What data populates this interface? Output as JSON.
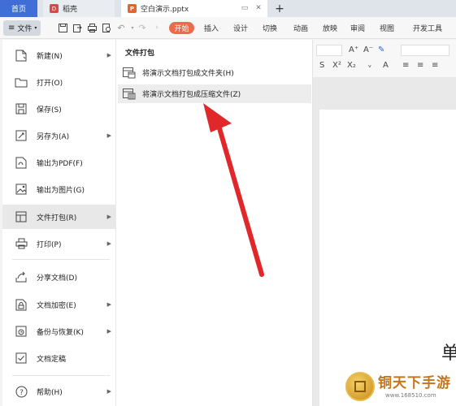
{
  "tabs": {
    "home": "首页",
    "docer": "稻壳",
    "document": "空白演示.pptx",
    "new_tab": "+"
  },
  "toolbar": {
    "file_menu": "文件",
    "ribbon_tabs": [
      "开始",
      "插入",
      "设计",
      "切换",
      "动画",
      "放映",
      "审阅",
      "视图",
      "开发工具"
    ]
  },
  "file_menu": {
    "items": [
      {
        "label": "新建(N)",
        "icon": "new-file-icon",
        "has_submenu": true
      },
      {
        "label": "打开(O)",
        "icon": "folder-open-icon",
        "has_submenu": false
      },
      {
        "label": "保存(S)",
        "icon": "save-icon",
        "has_submenu": false
      },
      {
        "label": "另存为(A)",
        "icon": "save-as-icon",
        "has_submenu": true
      },
      {
        "label": "输出为PDF(F)",
        "icon": "pdf-export-icon",
        "has_submenu": false
      },
      {
        "label": "输出为图片(G)",
        "icon": "image-export-icon",
        "has_submenu": false
      },
      {
        "label": "文件打包(R)",
        "icon": "package-icon",
        "has_submenu": true
      },
      {
        "label": "打印(P)",
        "icon": "printer-icon",
        "has_submenu": true
      },
      {
        "label": "分享文档(D)",
        "icon": "share-icon",
        "has_submenu": false
      },
      {
        "label": "文档加密(E)",
        "icon": "encrypt-icon",
        "has_submenu": true
      },
      {
        "label": "备份与恢复(K)",
        "icon": "backup-icon",
        "has_submenu": true
      },
      {
        "label": "文档定稿",
        "icon": "finalize-icon",
        "has_submenu": false
      },
      {
        "label": "帮助(H)",
        "icon": "help-icon",
        "has_submenu": true
      }
    ],
    "active_item": "文件打包(R)"
  },
  "submenu": {
    "title": "文件打包",
    "items": [
      {
        "label": "将演示文档打包成文件夹(H)",
        "icon": "package-folder-icon"
      },
      {
        "label": "将演示文档打包成压缩文件(Z)",
        "icon": "package-zip-icon"
      }
    ],
    "hovered_item": "将演示文档打包成压缩文件(Z)"
  },
  "canvas": {
    "partial_text": "单"
  },
  "watermark": {
    "name": "铜天下手游",
    "url": "www.168510.com"
  },
  "colors": {
    "accent": "#3f6ed6",
    "start_pill": "#ec6a4d",
    "arrow": "#e0282b",
    "menu_active": "#e8e8e8"
  }
}
